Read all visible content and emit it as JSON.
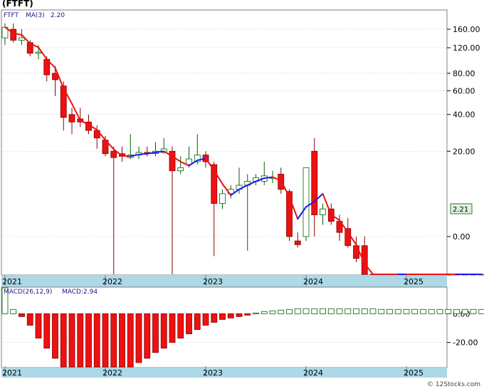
{
  "title": "(FTFT)",
  "footer": "© 12Stocks.com",
  "colors": {
    "up": "#ffffff",
    "up_stroke": "#006400",
    "down": "#ee1111",
    "down_stroke": "#8b0000",
    "ma_down": "#ee1111",
    "ma_up": "#1a1aee",
    "axis_band": "#add8e6",
    "macd_neg": "#ee1111",
    "macd_pos": "#006400",
    "grid": "#cccccc",
    "legend_text": "#1a1a8c"
  },
  "price_legend": {
    "symbol": "FTFT",
    "ma_label": "MA(3)",
    "ma_value": "2.20"
  },
  "last_price_label": "2.21",
  "price_ticks": [
    "160.00",
    "120.00",
    "80.00",
    "60.00",
    "40.00",
    "20.00",
    "0.00"
  ],
  "year_labels": [
    "2021",
    "2022",
    "2023",
    "2024",
    "2025"
  ],
  "macd_legend": {
    "label": "MACD(26,12,9)",
    "value_label": "MACD:2.94"
  },
  "macd_ticks": [
    "0.00",
    "-20.00"
  ],
  "chart_data": [
    {
      "type": "candlestick",
      "title": "(FTFT)",
      "period": "monthly",
      "y_scale": "log (price + 8)",
      "ylim": [
        0,
        200
      ],
      "moving_average": {
        "name": "MA(3)",
        "last": 2.2
      },
      "last_close": 2.21,
      "candles": [
        {
          "date": "2021-01",
          "o": 140,
          "h": 175,
          "l": 125,
          "c": 165
        },
        {
          "date": "2021-02",
          "o": 160,
          "h": 175,
          "l": 130,
          "c": 135
        },
        {
          "date": "2021-03",
          "o": 135,
          "h": 160,
          "l": 125,
          "c": 140
        },
        {
          "date": "2021-04",
          "o": 130,
          "h": 135,
          "l": 105,
          "c": 110
        },
        {
          "date": "2021-05",
          "o": 110,
          "h": 125,
          "l": 100,
          "c": 112
        },
        {
          "date": "2021-06",
          "o": 100,
          "h": 105,
          "l": 70,
          "c": 78
        },
        {
          "date": "2021-07",
          "o": 80,
          "h": 90,
          "l": 55,
          "c": 72
        },
        {
          "date": "2021-08",
          "o": 65,
          "h": 70,
          "l": 30,
          "c": 38
        },
        {
          "date": "2021-09",
          "o": 40,
          "h": 45,
          "l": 28,
          "c": 35
        },
        {
          "date": "2021-10",
          "o": 37,
          "h": 45,
          "l": 32,
          "c": 35
        },
        {
          "date": "2021-11",
          "o": 35,
          "h": 40,
          "l": 28,
          "c": 30
        },
        {
          "date": "2021-12",
          "o": 30,
          "h": 33,
          "l": 21,
          "c": 26
        },
        {
          "date": "2022-01",
          "o": 25,
          "h": 27,
          "l": 18,
          "c": 19
        },
        {
          "date": "2022-02",
          "o": 20,
          "h": 22,
          "l": -7.2,
          "c": 17.5
        },
        {
          "date": "2022-03",
          "o": 19,
          "h": 22,
          "l": 16,
          "c": 18
        },
        {
          "date": "2022-04",
          "o": 17.5,
          "h": 28,
          "l": 17,
          "c": 18.5
        },
        {
          "date": "2022-05",
          "o": 18.5,
          "h": 22,
          "l": 17,
          "c": 19.5
        },
        {
          "date": "2022-06",
          "o": 19.5,
          "h": 22,
          "l": 18,
          "c": 19
        },
        {
          "date": "2022-07",
          "o": 19,
          "h": 24,
          "l": 18,
          "c": 20
        },
        {
          "date": "2022-08",
          "o": 19.5,
          "h": 26,
          "l": 19,
          "c": 21
        },
        {
          "date": "2022-09",
          "o": 20,
          "h": 22,
          "l": -6.8,
          "c": 13
        },
        {
          "date": "2022-10",
          "o": 13,
          "h": 18,
          "l": 12,
          "c": 14
        },
        {
          "date": "2022-11",
          "o": 15,
          "h": 22,
          "l": 14,
          "c": 17
        },
        {
          "date": "2022-12",
          "o": 16,
          "h": 28,
          "l": 15,
          "c": 18.5
        },
        {
          "date": "2023-01",
          "o": 18.5,
          "h": 20,
          "l": 14,
          "c": 16
        },
        {
          "date": "2023-02",
          "o": 15,
          "h": 16,
          "l": -2,
          "c": 5
        },
        {
          "date": "2023-03",
          "o": 5,
          "h": 8,
          "l": 4,
          "c": 7
        },
        {
          "date": "2023-04",
          "o": 7,
          "h": 9,
          "l": 6,
          "c": 8
        },
        {
          "date": "2023-05",
          "o": 8,
          "h": 14,
          "l": 7,
          "c": 9
        },
        {
          "date": "2023-06",
          "o": 9,
          "h": 12,
          "l": -1.5,
          "c": 10
        },
        {
          "date": "2023-07",
          "o": 10,
          "h": 12,
          "l": 9,
          "c": 11
        },
        {
          "date": "2023-08",
          "o": 10,
          "h": 16,
          "l": 9,
          "c": 11.5
        },
        {
          "date": "2023-09",
          "o": 11,
          "h": 13,
          "l": 9.5,
          "c": 11
        },
        {
          "date": "2023-10",
          "o": 12,
          "h": 14,
          "l": 7,
          "c": 8
        },
        {
          "date": "2023-11",
          "o": 7.5,
          "h": 8,
          "l": -0.5,
          "c": 0
        },
        {
          "date": "2023-12",
          "o": -0.5,
          "h": 0.5,
          "l": -1.2,
          "c": -0.9
        },
        {
          "date": "2024-01",
          "o": 0,
          "h": 14,
          "l": -0.5,
          "c": 14
        },
        {
          "date": "2024-02",
          "o": 20,
          "h": 26,
          "l": 0,
          "c": 3
        },
        {
          "date": "2024-03",
          "o": 3,
          "h": 5,
          "l": 1.5,
          "c": 4
        },
        {
          "date": "2024-04",
          "o": 4,
          "h": 5,
          "l": 1.5,
          "c": 2
        },
        {
          "date": "2024-05",
          "o": 2,
          "h": 3,
          "l": -0.5,
          "c": 0.5
        },
        {
          "date": "2024-06",
          "o": 1,
          "h": 2.5,
          "l": -1.2,
          "c": -1
        },
        {
          "date": "2024-07",
          "o": -1,
          "h": 0,
          "l": -2.5,
          "c": -2.2
        },
        {
          "date": "2024-08",
          "o": -1,
          "h": 0,
          "l": -4.9,
          "c": -4.7
        },
        {
          "date": "2024-09",
          "o": -4.6,
          "h": -4.2,
          "l": -5.4,
          "c": -5.1
        },
        {
          "date": "2024-10",
          "o": -5.2,
          "h": -4.8,
          "l": -5.6,
          "c": -5.4
        },
        {
          "date": "2024-11",
          "o": -5.3,
          "h": -4.9,
          "l": -5.7,
          "c": -5.5
        },
        {
          "date": "2024-12",
          "o": -5.4,
          "h": -5.0,
          "l": -5.8,
          "c": -5.6
        },
        {
          "date": "2025-01",
          "o": -5.6,
          "h": -3.5,
          "l": -5.9,
          "c": -4.8
        },
        {
          "date": "2025-02",
          "o": -5.0,
          "h": -4.5,
          "l": -6.2,
          "c": -5.7
        },
        {
          "date": "2025-03",
          "o": -6.0,
          "h": -5.6,
          "l": -6.6,
          "c": -6.3
        },
        {
          "date": "2025-04",
          "o": -6.1,
          "h": -5.0,
          "l": -6.9,
          "c": -6.7
        },
        {
          "date": "2025-05",
          "o": -6.7,
          "h": -6.3,
          "l": -7.2,
          "c": -6.8
        },
        {
          "date": "2025-06",
          "o": -6.8,
          "h": -6.5,
          "l": -7.2,
          "c": -7.0
        },
        {
          "date": "2025-07",
          "o": -7.0,
          "h": -6.9,
          "l": -7.5,
          "c": -7.2
        },
        {
          "date": "2025-08",
          "o": -7.2,
          "h": -5.0,
          "l": -7.2,
          "c": -6.2
        },
        {
          "date": "2025-09",
          "o": -6.0,
          "h": -5.2,
          "l": -6.4,
          "c": -5.9
        },
        {
          "date": "2025-10",
          "o": -5.9,
          "h": -4.9,
          "l": -6.4,
          "c": -5.8
        }
      ]
    },
    {
      "type": "bar",
      "title": "MACD(26,12,9)",
      "last": 2.94,
      "ylim": [
        -37,
        18
      ],
      "values": [
        18,
        3,
        -2,
        -8,
        -17,
        -24,
        -31,
        -37,
        -42,
        -45,
        -47,
        -47,
        -46,
        -44,
        -41,
        -38,
        -34,
        -31,
        -27,
        -24,
        -20,
        -17,
        -14,
        -11,
        -8,
        -6,
        -4,
        -3,
        -2,
        -1,
        0.5,
        1.5,
        2,
        2.5,
        3,
        3.5,
        3.5,
        3.5,
        3.5,
        3.5,
        3.5,
        3.5,
        3.5,
        3.5,
        3.5,
        3,
        3,
        3,
        3,
        3,
        3,
        3,
        3,
        3,
        3,
        3,
        3,
        3,
        3
      ],
      "categories_start": "2021-01",
      "categories_end": "2025-10"
    }
  ]
}
